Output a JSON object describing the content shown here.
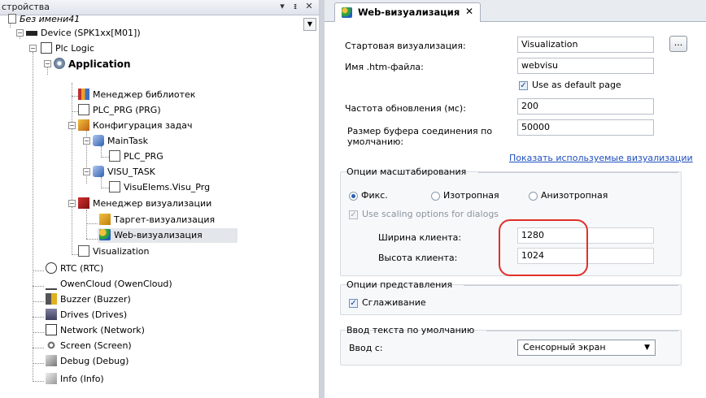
{
  "devices_panel": {
    "title": "стройства",
    "pin_label": "▾",
    "pin2_label": "ᵻ",
    "close_label": "✕",
    "dropdown_label": "▼",
    "tree": [
      {
        "label": "Без имени41",
        "icon": "project-file-icon",
        "italic": true
      },
      {
        "label": "Device (SPK1xx[M01])",
        "icon": "device-icon"
      },
      {
        "label": "Plc Logic",
        "icon": "plc-logic-icon"
      },
      {
        "label": "Application",
        "icon": "application-gear-icon",
        "bold": true
      },
      {
        "label": "Менеджер библиотек",
        "icon": "library-manager-icon"
      },
      {
        "label": "PLC_PRG (PRG)",
        "icon": "program-icon"
      },
      {
        "label": "Конфигурация задач",
        "icon": "task-configuration-icon"
      },
      {
        "label": "MainTask",
        "icon": "task-icon"
      },
      {
        "label": "PLC_PRG",
        "icon": "program-call-icon"
      },
      {
        "label": "VISU_TASK",
        "icon": "task-icon"
      },
      {
        "label": "VisuElems.Visu_Prg",
        "icon": "program-call-icon"
      },
      {
        "label": "Менеджер визуализации",
        "icon": "visualization-manager-icon"
      },
      {
        "label": "Таргет-визуализация",
        "icon": "target-visualization-icon"
      },
      {
        "label": "Web-визуализация",
        "icon": "web-visualization-icon",
        "selected": true
      },
      {
        "label": "Visualization",
        "icon": "visualization-icon"
      },
      {
        "label": "RTC (RTC)",
        "icon": "clock-icon"
      },
      {
        "label": "OwenCloud (OwenCloud)",
        "icon": "cloud-icon"
      },
      {
        "label": "Buzzer (Buzzer)",
        "icon": "buzzer-icon"
      },
      {
        "label": "Drives (Drives)",
        "icon": "drives-icon"
      },
      {
        "label": "Network (Network)",
        "icon": "network-icon"
      },
      {
        "label": "Screen (Screen)",
        "icon": "screen-icon"
      },
      {
        "label": "Debug (Debug)",
        "icon": "debug-icon"
      },
      {
        "label": "Info (Info)",
        "icon": "info-icon"
      }
    ]
  },
  "editor": {
    "tab_label": "Web-визуализация",
    "tab_close": "✕",
    "start_visu_label": "Стартовая визуализация:",
    "start_visu_value": "Visualization",
    "ellipsis_label": "...",
    "htm_label": "Имя .htm-файла:",
    "htm_value": "webvisu",
    "default_page_label": "Use as default page",
    "default_page_check": "✓",
    "refresh_label": "Частота обновления (мс):",
    "refresh_value": "200",
    "buffer_label_1": "Размер буфера соединения по",
    "buffer_label_2": "умолчанию:",
    "buffer_value": "50000",
    "show_visus_link": "Показать используемые визуализации",
    "scaling_group": "Опции масштабирования",
    "radio_fixed": "Фикс.",
    "radio_iso": "Изотропная",
    "radio_aniso": "Анизотропная",
    "scaling_dialogs_label": "Use scaling options for dialogs",
    "scaling_dialogs_check": "✓",
    "client_width_label": "Ширина клиента:",
    "client_width_value": "1280",
    "client_height_label": "Высота клиента:",
    "client_height_value": "1024",
    "presentation_group": "Опции представления",
    "antialias_label": "Сглаживание",
    "antialias_check": "✓",
    "text_input_group": "Ввод текста по умолчанию",
    "input_with_label": "Ввод с:",
    "input_with_value": "Сенсорный экран",
    "input_with_arrow": "▼"
  },
  "colors": {
    "highlight": "#e0302a",
    "link": "#1f4fbf"
  }
}
